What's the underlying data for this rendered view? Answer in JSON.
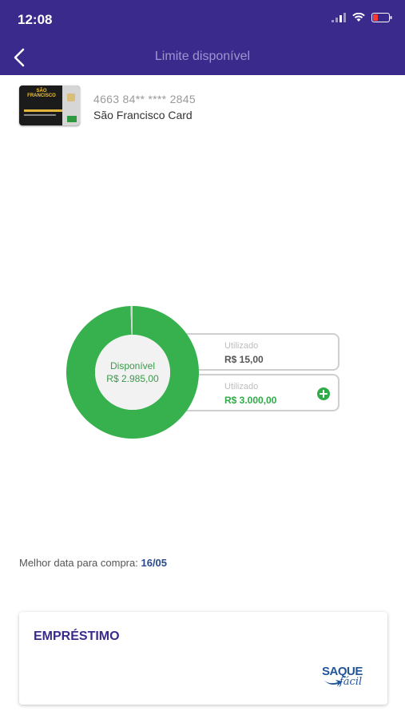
{
  "status_bar": {
    "time": "12:08"
  },
  "nav": {
    "title": "Limite disponível"
  },
  "card": {
    "brand_thumb": "SÃO FRANCISCO",
    "number": "4663 84** **** 2845",
    "name": "São Francisco Card"
  },
  "chart_data": {
    "type": "pie",
    "title": "",
    "series": [
      {
        "label": "Disponível",
        "value": 2985.0,
        "color": "#36b14d"
      },
      {
        "label": "Utilizado",
        "value": 15.0,
        "color": "#d4d4d4"
      }
    ]
  },
  "limits": {
    "available_label": "Disponível",
    "available_value": "R$ 2.985,00",
    "used_label": "Utilizado",
    "used_value": "R$ 15,00",
    "total_label": "Utilizado",
    "total_value": "R$ 3.000,00"
  },
  "best_date": {
    "label": "Melhor data para compra:",
    "value": "16/05"
  },
  "loan": {
    "title": "EMPRÉSTIMO",
    "logo_text_1": "SAQUE",
    "logo_text_2": "fácil"
  },
  "colors": {
    "header": "#3a2a8c",
    "green": "#36b14d",
    "blue_text": "#2a4a8c"
  }
}
